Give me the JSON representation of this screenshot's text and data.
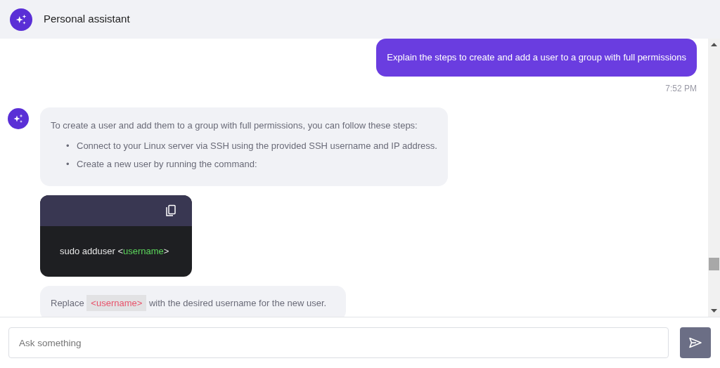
{
  "header": {
    "title": "Personal assistant"
  },
  "messages": [
    {
      "kind": "user",
      "text": "Explain the steps to create and add a user to a group with full permissions",
      "time": "7:52 PM"
    },
    {
      "kind": "assistant",
      "parts": [
        {
          "kind": "text",
          "paragraph": "To create a user and add them to a group with full permissions, you can follow these steps:",
          "bullets": [
            {
              "marker": "•",
              "text": "Connect to your Linux server via SSH using the provided SSH username and IP address."
            },
            {
              "marker": "•",
              "text": "Create a new user by running the command:"
            }
          ]
        },
        {
          "kind": "code",
          "segments": [
            {
              "kind": "plain",
              "text": "sudo adduser <"
            },
            {
              "kind": "placeholder",
              "text": "username"
            },
            {
              "kind": "plain",
              "text": ">"
            }
          ]
        },
        {
          "kind": "note",
          "segments": [
            {
              "kind": "plain",
              "text": "Replace"
            },
            {
              "kind": "code",
              "text": "<username>"
            },
            {
              "kind": "plain",
              "text": "with the desired username for the new user."
            }
          ]
        }
      ]
    }
  ],
  "composer": {
    "placeholder": "Ask something"
  }
}
